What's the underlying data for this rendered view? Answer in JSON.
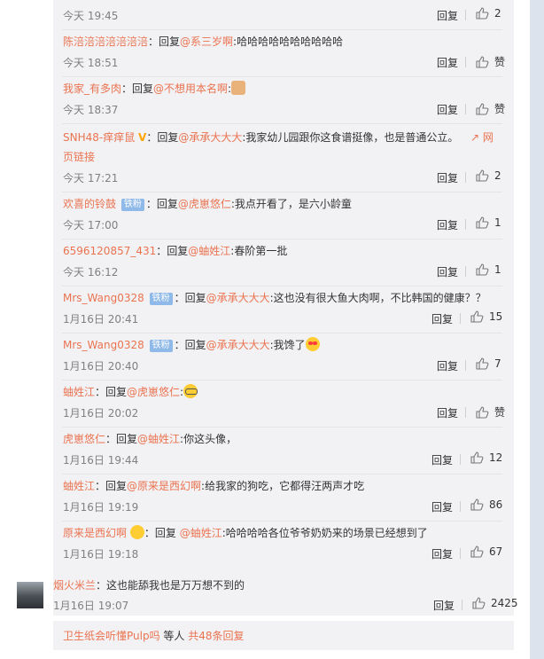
{
  "reply_label": "回复",
  "replies": [
    {
      "user": "",
      "time": "今天 19:45",
      "likes": "2"
    },
    {
      "user": "陈涪涪涪涪涪涪涪",
      "prefix": "：回复",
      "at": "@系三岁啊",
      "text": ":哈哈哈哈哈哈哈哈哈哈",
      "time": "今天 18:51",
      "likes": "赞"
    },
    {
      "user": "我家_有多肉",
      "prefix": "：回复",
      "at": "@不想用本名啊",
      "text": ":",
      "time": "今天 18:37",
      "likes": "赞"
    },
    {
      "user": "SNH48-痒痒鼠",
      "prefix": "：回复",
      "at": "@承承大大大",
      "text": ":我家幼儿园跟你这食谱挺像，也是普通公立。",
      "link1": "网",
      "link2": "页链接",
      "time": "今天 17:21",
      "likes": "2"
    },
    {
      "user": "欢喜的铃鼓",
      "badge": "铁粉",
      "prefix": "：回复",
      "at": "@虎崽悠仁",
      "text": ":我点开看了，是六小龄童",
      "time": "今天 17:00",
      "likes": "1"
    },
    {
      "user": "6596120857_431",
      "prefix": "：回复",
      "at": "@蚰姓江",
      "text": ":春阶第一批",
      "time": "今天 16:12",
      "likes": "1"
    },
    {
      "user": "Mrs_Wang0328",
      "badge": "铁粉",
      "prefix": "：回复",
      "at": "@承承大大大",
      "text": ":这也没有很大鱼大肉啊，不比韩国的健康？？",
      "time": "1月16日 20:41",
      "likes": "15"
    },
    {
      "user": "Mrs_Wang0328",
      "badge": "铁粉",
      "prefix": "：回复",
      "at": "@承承大大大",
      "text": ":我馋了",
      "time": "1月16日 20:40",
      "likes": "7"
    },
    {
      "user": "蚰姓江",
      "prefix": "：回复",
      "at": "@虎崽悠仁",
      "text": ":",
      "time": "1月16日 20:02",
      "likes": "赞"
    },
    {
      "user": "虎崽悠仁",
      "prefix": "：回复",
      "at": "@蚰姓江",
      "text": ":你这头像，",
      "time": "1月16日 19:44",
      "likes": "12"
    },
    {
      "user": "蚰姓江",
      "prefix": "：回复",
      "at": "@原来是西幻啊",
      "text": ":给我家的狗吃，它都得汪两声才吃",
      "time": "1月16日 19:19",
      "likes": "86"
    },
    {
      "user": "原来是西幻啊",
      "prefix": "：回复",
      "at": "@蚰姓江",
      "text": ":哈哈哈哈各位爷爷奶奶来的场景已经想到了",
      "time": "1月16日 19:18",
      "likes": "67"
    }
  ],
  "main_comment": {
    "user": "烟火米兰",
    "text": "：这也能舔我也是万万想不到的",
    "time": "1月16日 19:07",
    "likes": "2425"
  },
  "footer": {
    "users": "卫生纸会听懂Pulp吗",
    "mid": " 等人 ",
    "count": "共48条回复"
  }
}
